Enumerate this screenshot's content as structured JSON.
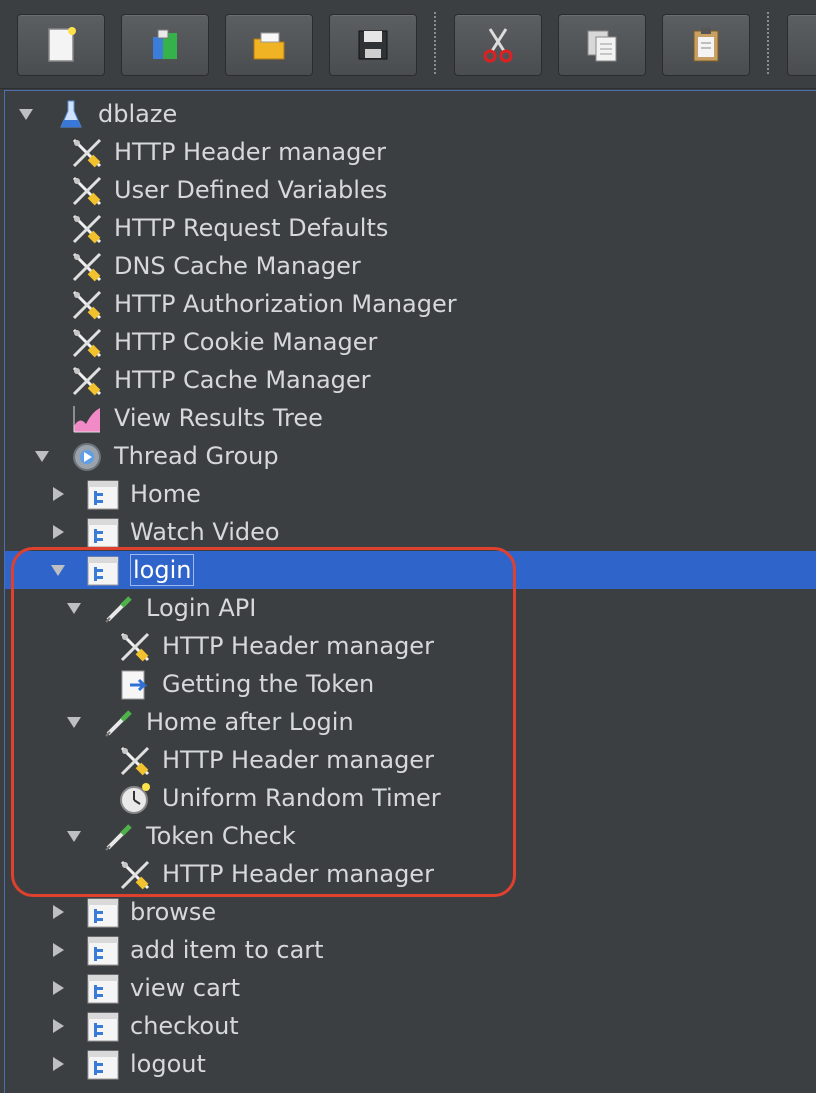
{
  "toolbar": {
    "buttons": [
      {
        "name": "new-button",
        "icon": "new-document-icon"
      },
      {
        "name": "templates-button",
        "icon": "templates-icon"
      },
      {
        "name": "open-button",
        "icon": "open-folder-icon"
      },
      {
        "name": "save-button",
        "icon": "save-icon"
      },
      {
        "name": "cut-button",
        "icon": "cut-icon"
      },
      {
        "name": "copy-button",
        "icon": "copy-icon"
      },
      {
        "name": "paste-button",
        "icon": "paste-icon"
      }
    ]
  },
  "tree": {
    "root": "dblaze",
    "items": [
      {
        "label": "dblaze",
        "icon": "test-plan-icon",
        "expanded": true
      },
      {
        "label": "HTTP Header manager",
        "icon": "config-element-icon"
      },
      {
        "label": "User Defined Variables",
        "icon": "config-element-icon"
      },
      {
        "label": "HTTP Request Defaults",
        "icon": "config-element-icon"
      },
      {
        "label": "DNS Cache Manager",
        "icon": "config-element-icon"
      },
      {
        "label": "HTTP Authorization Manager",
        "icon": "config-element-icon"
      },
      {
        "label": "HTTP Cookie Manager",
        "icon": "config-element-icon"
      },
      {
        "label": "HTTP Cache Manager",
        "icon": "config-element-icon"
      },
      {
        "label": "View Results Tree",
        "icon": "listener-icon"
      },
      {
        "label": "Thread Group",
        "icon": "thread-group-icon",
        "expanded": true
      },
      {
        "label": "Home",
        "icon": "controller-icon",
        "expanded": false
      },
      {
        "label": "Watch Video",
        "icon": "controller-icon",
        "expanded": false
      },
      {
        "label": "login",
        "icon": "controller-icon",
        "expanded": true,
        "selected": true
      },
      {
        "label": "Login API",
        "icon": "sampler-icon",
        "expanded": true
      },
      {
        "label": "HTTP Header manager",
        "icon": "config-element-icon"
      },
      {
        "label": "Getting the Token",
        "icon": "post-processor-icon"
      },
      {
        "label": "Home after Login",
        "icon": "sampler-icon",
        "expanded": true
      },
      {
        "label": "HTTP Header manager",
        "icon": "config-element-icon"
      },
      {
        "label": "Uniform Random Timer",
        "icon": "timer-icon"
      },
      {
        "label": "Token Check",
        "icon": "sampler-icon",
        "expanded": true
      },
      {
        "label": "HTTP Header manager",
        "icon": "config-element-icon"
      },
      {
        "label": "browse",
        "icon": "controller-icon",
        "expanded": false
      },
      {
        "label": "add item to cart",
        "icon": "controller-icon",
        "expanded": false
      },
      {
        "label": "view cart",
        "icon": "controller-icon",
        "expanded": false
      },
      {
        "label": "checkout",
        "icon": "controller-icon",
        "expanded": false
      },
      {
        "label": "logout",
        "icon": "controller-icon",
        "expanded": false
      }
    ]
  },
  "colors": {
    "background": "#3c3f41",
    "selection": "#2f65ca",
    "highlight_box": "#e0402e",
    "text": "#d6d8da"
  }
}
